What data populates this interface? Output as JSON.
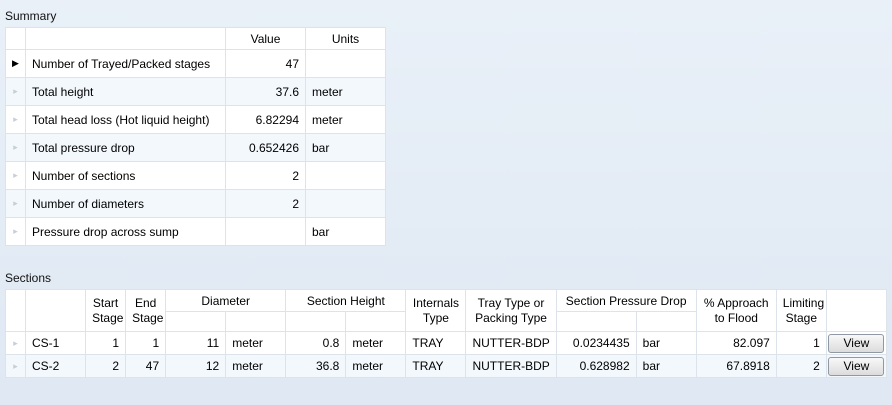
{
  "summary": {
    "label": "Summary",
    "columns": {
      "value": "Value",
      "units": "Units"
    },
    "rows": [
      {
        "label": "Number of Trayed/Packed stages",
        "value": "47",
        "units": ""
      },
      {
        "label": "Total height",
        "value": "37.6",
        "units": "meter"
      },
      {
        "label": "Total head loss (Hot liquid height)",
        "value": "6.82294",
        "units": "meter"
      },
      {
        "label": "Total pressure drop",
        "value": "0.652426",
        "units": "bar"
      },
      {
        "label": "Number of sections",
        "value": "2",
        "units": ""
      },
      {
        "label": "Number of diameters",
        "value": "2",
        "units": ""
      },
      {
        "label": "Pressure drop across sump",
        "value": "",
        "units": "bar"
      }
    ],
    "active_row_marker": "▶",
    "inactive_row_marker": "▸"
  },
  "sections": {
    "label": "Sections",
    "headers": {
      "start_stage": "Start Stage",
      "end_stage": "End Stage",
      "diameter": "Diameter",
      "section_height": "Section Height",
      "internals_type": "Internals Type",
      "tray_type": "Tray Type or Packing Type",
      "pressure_drop": "Section Pressure Drop",
      "approach_flood": "% Approach to Flood",
      "limiting_stage": "Limiting Stage"
    },
    "rows": [
      {
        "name": "CS-1",
        "start": "1",
        "end": "1",
        "diameter": "11",
        "diameter_units": "meter",
        "height": "0.8",
        "height_units": "meter",
        "internals": "TRAY",
        "tray_type": "NUTTER-BDP",
        "dp": "0.0234435",
        "dp_units": "bar",
        "flood": "82.097",
        "limiting": "1",
        "button": "View"
      },
      {
        "name": "CS-2",
        "start": "2",
        "end": "47",
        "diameter": "12",
        "diameter_units": "meter",
        "height": "36.8",
        "height_units": "meter",
        "internals": "TRAY",
        "tray_type": "NUTTER-BDP",
        "dp": "0.628982",
        "dp_units": "bar",
        "flood": "67.8918",
        "limiting": "2",
        "button": "View"
      }
    ]
  }
}
